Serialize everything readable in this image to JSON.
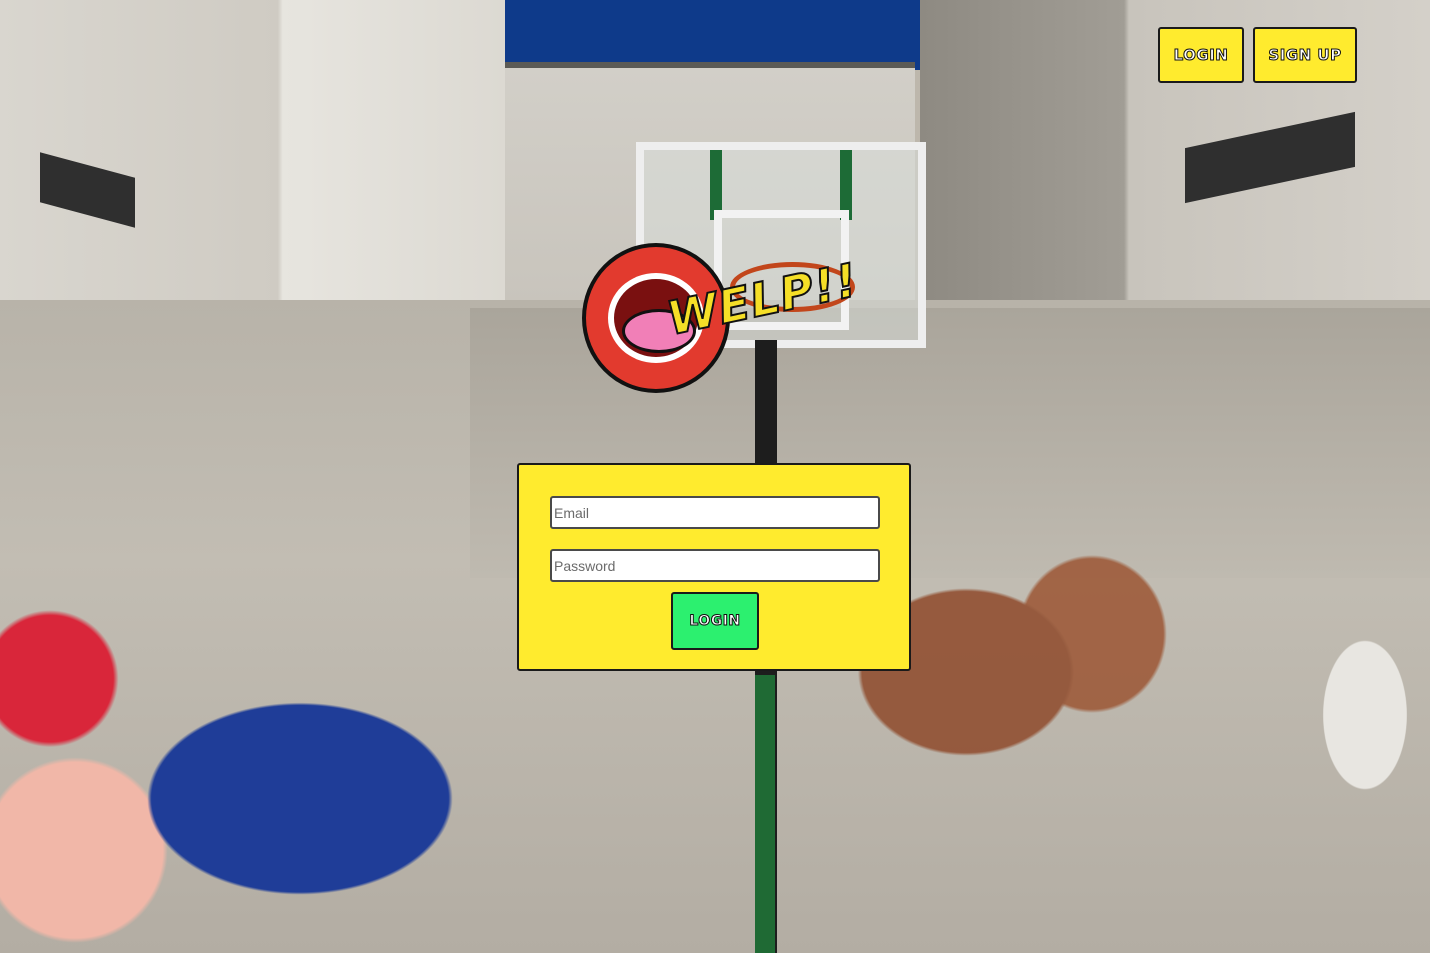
{
  "header": {
    "login_label": "LOGIN",
    "signup_label": "SIGN UP"
  },
  "logo": {
    "text": "WELP!!"
  },
  "form": {
    "email_placeholder": "Email",
    "password_placeholder": "Password",
    "submit_label": "LOGIN"
  },
  "colors": {
    "primary_yellow": "#ffeb2e",
    "submit_green": "#2cf06f"
  }
}
